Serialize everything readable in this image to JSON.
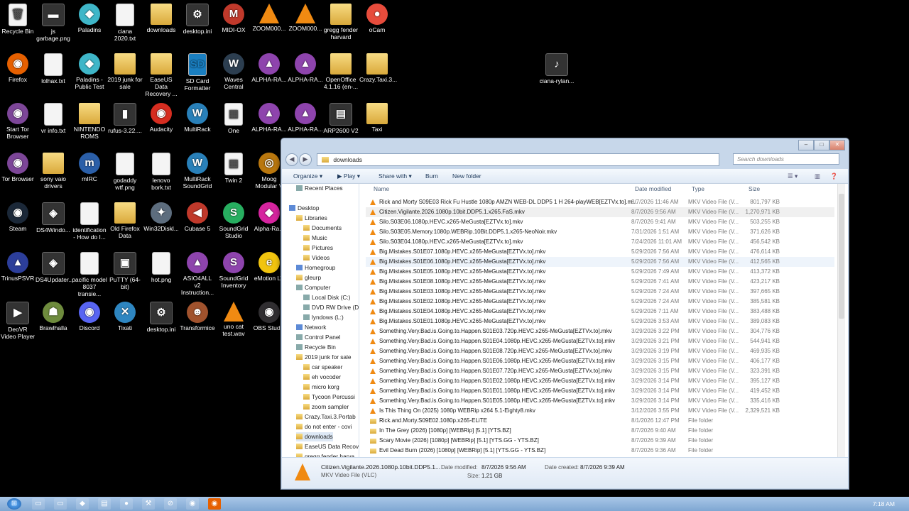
{
  "desktop": {
    "icons": [
      {
        "label": "Recycle Bin",
        "glyph": "🗑",
        "kind": "file",
        "col": 0,
        "row": 0
      },
      {
        "label": "js garbage.png",
        "glyph": "▬",
        "kind": "dark",
        "col": 1,
        "row": 0
      },
      {
        "label": "Paladins",
        "glyph": "◆",
        "kind": "round",
        "col": 2,
        "row": 0,
        "color": "#3fb6c8"
      },
      {
        "label": "ciana 2020.txt",
        "glyph": "",
        "kind": "file",
        "col": 3,
        "row": 0
      },
      {
        "label": "downloads",
        "glyph": "",
        "kind": "folder",
        "col": 4,
        "row": 0
      },
      {
        "label": "desktop.ini",
        "glyph": "⚙",
        "kind": "dark",
        "col": 5,
        "row": 0
      },
      {
        "label": "MIDI-OX",
        "glyph": "M",
        "kind": "round",
        "col": 6,
        "row": 0,
        "color": "#c0392b"
      },
      {
        "label": "ZOOM000...",
        "glyph": "",
        "kind": "vlc",
        "col": 7,
        "row": 0
      },
      {
        "label": "ZOOM000...",
        "glyph": "",
        "kind": "vlc",
        "col": 8,
        "row": 0
      },
      {
        "label": "gregg fender harvard",
        "glyph": "",
        "kind": "folder",
        "col": 9,
        "row": 0
      },
      {
        "label": "oCam",
        "glyph": "●",
        "kind": "round",
        "col": 10,
        "row": 0,
        "color": "#e74c3c"
      },
      {
        "label": "Firefox",
        "glyph": "◉",
        "kind": "round",
        "col": 0,
        "row": 1,
        "color": "#e66000"
      },
      {
        "label": "lolhax.txt",
        "glyph": "",
        "kind": "file",
        "col": 1,
        "row": 1
      },
      {
        "label": "Paladins - Public Test",
        "glyph": "◆",
        "kind": "round",
        "col": 2,
        "row": 1,
        "color": "#3fb6c8"
      },
      {
        "label": "2019 junk for sale",
        "glyph": "",
        "kind": "folder",
        "col": 3,
        "row": 1
      },
      {
        "label": "EaseUS Data Recovery ...",
        "glyph": "",
        "kind": "folder",
        "col": 4,
        "row": 1
      },
      {
        "label": "SD Card Formatter",
        "glyph": "SD",
        "kind": "file",
        "col": 5,
        "row": 1,
        "color": "#1a7fc1"
      },
      {
        "label": "Waves Central",
        "glyph": "W",
        "kind": "round",
        "col": 6,
        "row": 1,
        "color": "#2c3e50"
      },
      {
        "label": "ALPHA-RA...",
        "glyph": "▲",
        "kind": "round",
        "col": 7,
        "row": 1,
        "color": "#8e44ad"
      },
      {
        "label": "ALPHA-RA...",
        "glyph": "▲",
        "kind": "round",
        "col": 8,
        "row": 1,
        "color": "#8e44ad"
      },
      {
        "label": "OpenOffice 4.1.16 (en-...",
        "glyph": "",
        "kind": "folder",
        "col": 9,
        "row": 1
      },
      {
        "label": "Crazy.Taxi.3...",
        "glyph": "",
        "kind": "folder",
        "col": 10,
        "row": 1
      },
      {
        "label": "ciana-rylan...",
        "glyph": "♪",
        "kind": "dark",
        "col": 15,
        "row": 1
      },
      {
        "label": "Start Tor Browser",
        "glyph": "◉",
        "kind": "round",
        "col": 0,
        "row": 2,
        "color": "#7d4698"
      },
      {
        "label": "vr info.txt",
        "glyph": "",
        "kind": "file",
        "col": 1,
        "row": 2
      },
      {
        "label": "NINTENDO ROMS",
        "glyph": "",
        "kind": "folder",
        "col": 2,
        "row": 2
      },
      {
        "label": "rufus-3.22....",
        "glyph": "▮",
        "kind": "dark",
        "col": 3,
        "row": 2
      },
      {
        "label": "Audacity",
        "glyph": "◉",
        "kind": "round",
        "col": 4,
        "row": 2,
        "color": "#d62d20"
      },
      {
        "label": "MultiRack",
        "glyph": "W",
        "kind": "round",
        "col": 5,
        "row": 2,
        "color": "#2980b9"
      },
      {
        "label": "One",
        "glyph": "▦",
        "kind": "file",
        "col": 6,
        "row": 2
      },
      {
        "label": "ALPHA-RA...",
        "glyph": "▲",
        "kind": "round",
        "col": 7,
        "row": 2,
        "color": "#8e44ad"
      },
      {
        "label": "ALPHA-RA...",
        "glyph": "▲",
        "kind": "round",
        "col": 8,
        "row": 2,
        "color": "#8e44ad"
      },
      {
        "label": "ARP2600 V2",
        "glyph": "▤",
        "kind": "dark",
        "col": 9,
        "row": 2
      },
      {
        "label": "Taxi",
        "glyph": "",
        "kind": "folder",
        "col": 10,
        "row": 2
      },
      {
        "label": "Tor Browser",
        "glyph": "◉",
        "kind": "round",
        "col": 0,
        "row": 3,
        "color": "#7d4698"
      },
      {
        "label": "sony vaio drivers",
        "glyph": "",
        "kind": "folder",
        "col": 1,
        "row": 3
      },
      {
        "label": "mIRC",
        "glyph": "m",
        "kind": "round",
        "col": 2,
        "row": 3,
        "color": "#2b5fa8"
      },
      {
        "label": "godaddy wtf.png",
        "glyph": "",
        "kind": "file",
        "col": 3,
        "row": 3
      },
      {
        "label": "lenovo bork.txt",
        "glyph": "",
        "kind": "file",
        "col": 4,
        "row": 3
      },
      {
        "label": "MultiRack SoundGrid",
        "glyph": "W",
        "kind": "round",
        "col": 5,
        "row": 3,
        "color": "#2980b9"
      },
      {
        "label": "Twin 2",
        "glyph": "▦",
        "kind": "file",
        "col": 6,
        "row": 3
      },
      {
        "label": "Moog Modular V",
        "glyph": "◎",
        "kind": "round",
        "col": 7,
        "row": 3,
        "color": "#b9770e"
      },
      {
        "label": "Steam",
        "glyph": "◉",
        "kind": "round",
        "col": 0,
        "row": 4,
        "color": "#1b2838"
      },
      {
        "label": "DS4Windo...",
        "glyph": "◈",
        "kind": "dark",
        "col": 1,
        "row": 4
      },
      {
        "label": "identification - How do I...",
        "glyph": "",
        "kind": "file",
        "col": 2,
        "row": 4
      },
      {
        "label": "Old Firefox Data",
        "glyph": "",
        "kind": "folder",
        "col": 3,
        "row": 4
      },
      {
        "label": "Win32Diskl...",
        "glyph": "✦",
        "kind": "round",
        "col": 4,
        "row": 4,
        "color": "#5d6d7e"
      },
      {
        "label": "Cubase 5",
        "glyph": "◀",
        "kind": "round",
        "col": 5,
        "row": 4,
        "color": "#c0392b"
      },
      {
        "label": "SoundGrid Studio",
        "glyph": "S",
        "kind": "round",
        "col": 6,
        "row": 4,
        "color": "#27ae60"
      },
      {
        "label": "Alpha-Ra...",
        "glyph": "◆",
        "kind": "round",
        "col": 7,
        "row": 4,
        "color": "#d6249f"
      },
      {
        "label": "TrinusPSVR",
        "glyph": "▲",
        "kind": "round",
        "col": 0,
        "row": 5,
        "color": "#2c3e9a"
      },
      {
        "label": "DS4Updater...",
        "glyph": "◈",
        "kind": "dark",
        "col": 1,
        "row": 5
      },
      {
        "label": "pacific model 8037 transie...",
        "glyph": "",
        "kind": "file",
        "col": 2,
        "row": 5
      },
      {
        "label": "PuTTY (64-bit)",
        "glyph": "▣",
        "kind": "dark",
        "col": 3,
        "row": 5
      },
      {
        "label": "hot.png",
        "glyph": "",
        "kind": "file",
        "col": 4,
        "row": 5
      },
      {
        "label": "ASIO4ALL v2 Instruction...",
        "glyph": "▲",
        "kind": "round",
        "col": 5,
        "row": 5,
        "color": "#8e44ad"
      },
      {
        "label": "SoundGrid Inventory",
        "glyph": "S",
        "kind": "round",
        "col": 6,
        "row": 5,
        "color": "#8e44ad"
      },
      {
        "label": "eMotion LV",
        "glyph": "e",
        "kind": "round",
        "col": 7,
        "row": 5,
        "color": "#f1c40f"
      },
      {
        "label": "DeoVR Video Player",
        "glyph": "▶",
        "kind": "dark",
        "col": 0,
        "row": 6
      },
      {
        "label": "Brawlhalla",
        "glyph": "☗",
        "kind": "round",
        "col": 1,
        "row": 6,
        "color": "#6e8b3d"
      },
      {
        "label": "Discord",
        "glyph": "◉",
        "kind": "round",
        "col": 2,
        "row": 6,
        "color": "#5865f2"
      },
      {
        "label": "Tixati",
        "glyph": "✕",
        "kind": "round",
        "col": 3,
        "row": 6,
        "color": "#2e86c1"
      },
      {
        "label": "desktop.ini",
        "glyph": "⚙",
        "kind": "dark",
        "col": 4,
        "row": 6
      },
      {
        "label": "Transformice",
        "glyph": "☻",
        "kind": "round",
        "col": 5,
        "row": 6,
        "color": "#a0522d"
      },
      {
        "label": "uno cat test.wav",
        "glyph": "",
        "kind": "vlc",
        "col": 6,
        "row": 6
      },
      {
        "label": "OBS Studio",
        "glyph": "◉",
        "kind": "round",
        "col": 7,
        "row": 6,
        "color": "#302e31"
      }
    ]
  },
  "explorer": {
    "caption_buttons": {
      "minimize": "–",
      "maximize": "□",
      "close": "✕"
    },
    "nav_back": "◀",
    "nav_forward": "▶",
    "address_path": "downloads",
    "search_placeholder": "Search downloads",
    "toolbar": {
      "organize": "Organize ▾",
      "play": "▶ Play ▾",
      "share_with": "Share with ▾",
      "burn": "Burn",
      "new_folder": "New folder"
    },
    "nav_items": [
      {
        "label": "Recent Places",
        "depth": 1,
        "icon": "g"
      },
      {
        "label": "Desktop",
        "depth": 0,
        "icon": "b"
      },
      {
        "label": "Libraries",
        "depth": 1,
        "icon": "f"
      },
      {
        "label": "Documents",
        "depth": 2,
        "icon": "f"
      },
      {
        "label": "Music",
        "depth": 2,
        "icon": "f"
      },
      {
        "label": "Pictures",
        "depth": 2,
        "icon": "f"
      },
      {
        "label": "Videos",
        "depth": 2,
        "icon": "f"
      },
      {
        "label": "Homegroup",
        "depth": 1,
        "icon": "b"
      },
      {
        "label": "gleurp",
        "depth": 1,
        "icon": "f"
      },
      {
        "label": "Computer",
        "depth": 1,
        "icon": "g"
      },
      {
        "label": "Local Disk (C:)",
        "depth": 2,
        "icon": "g"
      },
      {
        "label": "DVD RW Drive (D",
        "depth": 2,
        "icon": "g"
      },
      {
        "label": "lyndows (L:)",
        "depth": 2,
        "icon": "g"
      },
      {
        "label": "Network",
        "depth": 1,
        "icon": "b"
      },
      {
        "label": "Control Panel",
        "depth": 1,
        "icon": "g"
      },
      {
        "label": "Recycle Bin",
        "depth": 1,
        "icon": "g"
      },
      {
        "label": "2019 junk for sale",
        "depth": 1,
        "icon": "f"
      },
      {
        "label": "car speaker",
        "depth": 2,
        "icon": "f"
      },
      {
        "label": "eh vocoder",
        "depth": 2,
        "icon": "f"
      },
      {
        "label": "micro korg",
        "depth": 2,
        "icon": "f"
      },
      {
        "label": "Tycoon Percussi",
        "depth": 2,
        "icon": "f"
      },
      {
        "label": "zoom sampler",
        "depth": 2,
        "icon": "f"
      },
      {
        "label": "Crazy.Taxi.3.Portab",
        "depth": 1,
        "icon": "f"
      },
      {
        "label": "do not enter - covi",
        "depth": 1,
        "icon": "f"
      },
      {
        "label": "downloads",
        "depth": 1,
        "icon": "f"
      },
      {
        "label": "EaseUS Data Recov",
        "depth": 1,
        "icon": "f"
      },
      {
        "label": "gregg fender harva",
        "depth": 1,
        "icon": "f"
      }
    ],
    "columns": {
      "name": "Name",
      "date": "Date modified",
      "type": "Type",
      "size": "Size"
    },
    "files": [
      {
        "name": "Rick and Morty S09E03 Rick Fu Hustle 1080p AMZN WEB-DL DDP5 1 H 264-playWEB[EZTVx.to].m...",
        "date": "8/7/2026 11:46 AM",
        "type": "MKV Video File (V...",
        "size": "801,797 KB",
        "kind": "vlc"
      },
      {
        "name": "Citizen.Vigilante.2026.1080p.10bit.DDP5.1.x265.FaS.mkv",
        "date": "8/7/2026 9:56 AM",
        "type": "MKV Video File (V...",
        "size": "1,270,971 KB",
        "kind": "vlc",
        "selected": true
      },
      {
        "name": "Silo.S03E06.1080p.HEVC.x265-MeGusta[EZTVx.to].mkv",
        "date": "8/7/2026 9:41 AM",
        "type": "MKV Video File (V...",
        "size": "503,255 KB",
        "kind": "vlc"
      },
      {
        "name": "Silo.S03E05.Memory.1080p.WEBRip.10Bit.DDP5.1.x265-NeoNoir.mkv",
        "date": "7/31/2026 1:51 AM",
        "type": "MKV Video File (V...",
        "size": "371,626 KB",
        "kind": "vlc"
      },
      {
        "name": "Silo.S03E04.1080p.HEVC.x265-MeGusta[EZTVx.to].mkv",
        "date": "7/24/2026 11:01 AM",
        "type": "MKV Video File (V...",
        "size": "456,542 KB",
        "kind": "vlc"
      },
      {
        "name": "Big.Mistakes.S01E07.1080p.HEVC.x265-MeGusta[EZTVx.to].mkv",
        "date": "5/29/2026 7:56 AM",
        "type": "MKV Video File (V...",
        "size": "476,614 KB",
        "kind": "vlc"
      },
      {
        "name": "Big.Mistakes.S01E06.1080p.HEVC.x265-MeGusta[EZTVx.to].mkv",
        "date": "5/29/2026 7:56 AM",
        "type": "MKV Video File (V...",
        "size": "412,565 KB",
        "kind": "vlc",
        "hover": true
      },
      {
        "name": "Big.Mistakes.S01E05.1080p.HEVC.x265-MeGusta[EZTVx.to].mkv",
        "date": "5/29/2026 7:49 AM",
        "type": "MKV Video File (V...",
        "size": "413,372 KB",
        "kind": "vlc"
      },
      {
        "name": "Big.Mistakes.S01E08.1080p.HEVC.x265-MeGusta[EZTVx.to].mkv",
        "date": "5/29/2026 7:41 AM",
        "type": "MKV Video File (V...",
        "size": "423,217 KB",
        "kind": "vlc"
      },
      {
        "name": "Big.Mistakes.S01E03.1080p.HEVC.x265-MeGusta[EZTVx.to].mkv",
        "date": "5/29/2026 7:24 AM",
        "type": "MKV Video File (V...",
        "size": "397,665 KB",
        "kind": "vlc"
      },
      {
        "name": "Big.Mistakes.S01E02.1080p.HEVC.x265-MeGusta[EZTVx.to].mkv",
        "date": "5/29/2026 7:24 AM",
        "type": "MKV Video File (V...",
        "size": "385,581 KB",
        "kind": "vlc"
      },
      {
        "name": "Big.Mistakes.S01E04.1080p.HEVC.x265-MeGusta[EZTVx.to].mkv",
        "date": "5/29/2026 7:11 AM",
        "type": "MKV Video File (V...",
        "size": "383,488 KB",
        "kind": "vlc"
      },
      {
        "name": "Big.Mistakes.S01E01.1080p.HEVC.x265-MeGusta[EZTVx.to].mkv",
        "date": "5/29/2026 3:53 AM",
        "type": "MKV Video File (V...",
        "size": "389,083 KB",
        "kind": "vlc"
      },
      {
        "name": "Something.Very.Bad.is.Going.to.Happen.S01E03.720p.HEVC.x265-MeGusta[EZTVx.to].mkv",
        "date": "3/29/2026 3:22 PM",
        "type": "MKV Video File (V...",
        "size": "304,776 KB",
        "kind": "vlc"
      },
      {
        "name": "Something.Very.Bad.is.Going.to.Happen.S01E04.1080p.HEVC.x265-MeGusta[EZTVx.to].mkv",
        "date": "3/29/2026 3:21 PM",
        "type": "MKV Video File (V...",
        "size": "544,941 KB",
        "kind": "vlc"
      },
      {
        "name": "Something.Very.Bad.is.Going.to.Happen.S01E08.720p.HEVC.x265-MeGusta[EZTVx.to].mkv",
        "date": "3/29/2026 3:19 PM",
        "type": "MKV Video File (V...",
        "size": "469,935 KB",
        "kind": "vlc"
      },
      {
        "name": "Something.Very.Bad.is.Going.to.Happen.S01E06.1080p.HEVC.x265-MeGusta[EZTVx.to].mkv",
        "date": "3/29/2026 3:15 PM",
        "type": "MKV Video File (V...",
        "size": "406,177 KB",
        "kind": "vlc"
      },
      {
        "name": "Something.Very.Bad.is.Going.to.Happen.S01E07.720p.HEVC.x265-MeGusta[EZTVx.to].mkv",
        "date": "3/29/2026 3:15 PM",
        "type": "MKV Video File (V...",
        "size": "323,391 KB",
        "kind": "vlc"
      },
      {
        "name": "Something.Very.Bad.is.Going.to.Happen.S01E02.1080p.HEVC.x265-MeGusta[EZTVx.to].mkv",
        "date": "3/29/2026 3:14 PM",
        "type": "MKV Video File (V...",
        "size": "395,127 KB",
        "kind": "vlc"
      },
      {
        "name": "Something.Very.Bad.is.Going.to.Happen.S01E01.1080p.HEVC.x265-MeGusta[EZTVx.to].mkv",
        "date": "3/29/2026 3:14 PM",
        "type": "MKV Video File (V...",
        "size": "419,452 KB",
        "kind": "vlc"
      },
      {
        "name": "Something.Very.Bad.is.Going.to.Happen.S01E05.1080p.HEVC.x265-MeGusta[EZTVx.to].mkv",
        "date": "3/29/2026 3:14 PM",
        "type": "MKV Video File (V...",
        "size": "335,416 KB",
        "kind": "vlc"
      },
      {
        "name": "Is This Thing On (2025) 1080p WEBRip x264 5.1-Eighty8.mkv",
        "date": "3/12/2026 3:55 PM",
        "type": "MKV Video File (V...",
        "size": "2,329,521 KB",
        "kind": "vlc"
      },
      {
        "name": "Rick.and.Morty.S09E02.1080p.x265-ELiTE",
        "date": "8/1/2026 12:47 PM",
        "type": "File folder",
        "size": "",
        "kind": "folder"
      },
      {
        "name": "In The Grey (2026) [1080p] [WEBRip] [5.1] [YTS.BZ]",
        "date": "8/7/2026 9:40 AM",
        "type": "File folder",
        "size": "",
        "kind": "folder"
      },
      {
        "name": "Scary Movie (2026) [1080p] [WEBRip] [5.1] [YTS.GG - YTS.BZ]",
        "date": "8/7/2026 9:39 AM",
        "type": "File folder",
        "size": "",
        "kind": "folder"
      },
      {
        "name": "Evil Dead Burn (2026) [1080p] [WEBRip] [5.1] [YTS.GG - YTS.BZ]",
        "date": "8/7/2026 9:36 AM",
        "type": "File folder",
        "size": "",
        "kind": "folder"
      }
    ],
    "details": {
      "filename": "Citizen.Vigilante.2026.1080p.10bit.DDP5.1...",
      "filetype": "MKV Video File (VLC)",
      "modified_label": "Date modified:",
      "modified": "8/7/2026 9:56 AM",
      "created_label": "Date created:",
      "created": "8/7/2026 9:39 AM",
      "size_label": "Size:",
      "size": "1.21 GB"
    }
  },
  "taskbar": {
    "start_glyph": "⊞",
    "items": [
      "▭",
      "▭",
      "◆",
      "▤",
      "●",
      "⚒",
      "⊘",
      "◉",
      "◉"
    ],
    "clock": "7:18 AM"
  }
}
